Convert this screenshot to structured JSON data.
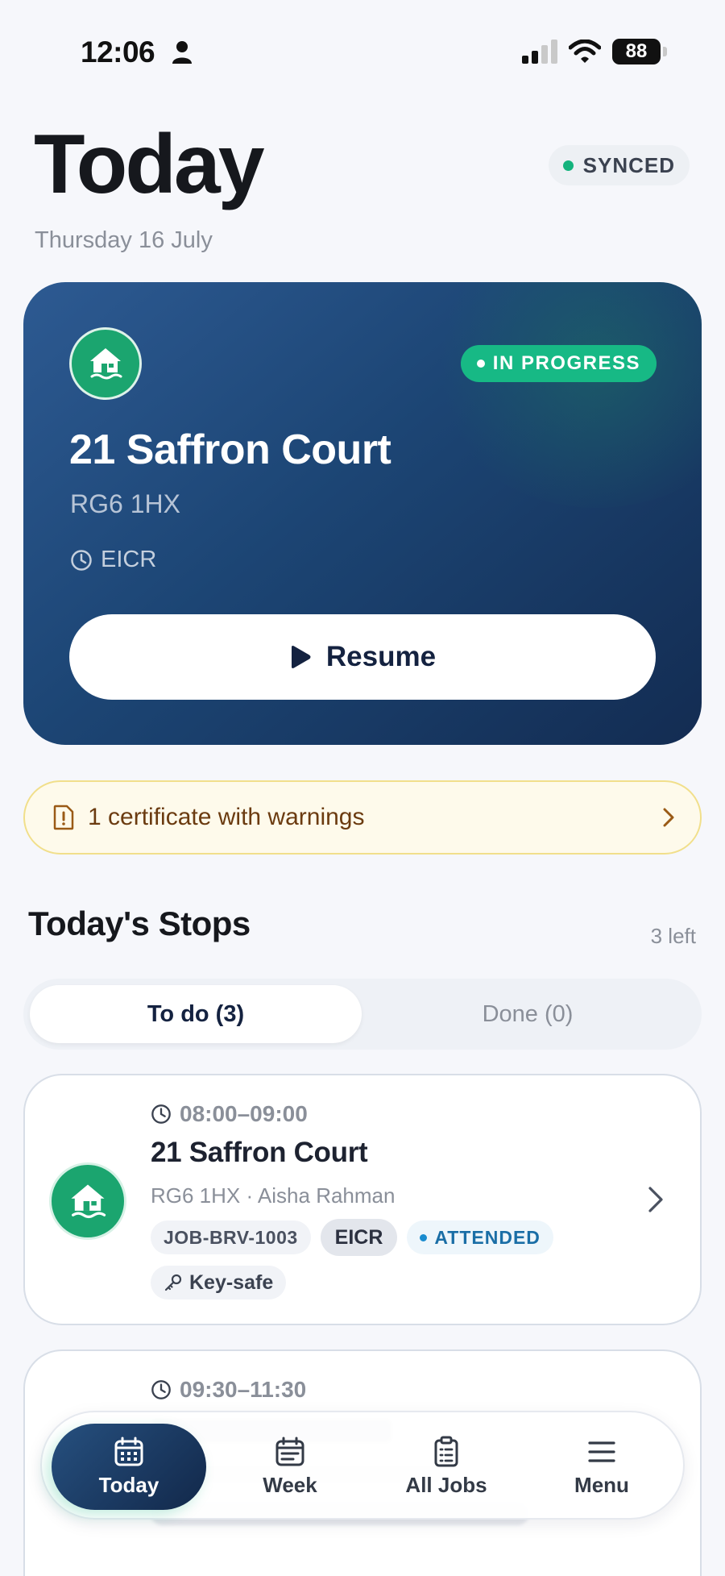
{
  "status_bar": {
    "time": "12:06",
    "battery": "88"
  },
  "header": {
    "title": "Today",
    "date": "Thursday 16 July",
    "sync_label": "SYNCED"
  },
  "hero": {
    "status": "IN PROGRESS",
    "address": "21 Saffron Court",
    "postcode": "RG6 1HX",
    "job_type": "EICR",
    "resume_label": "Resume"
  },
  "warning": {
    "text": "1 certificate with warnings"
  },
  "stops": {
    "title": "Today's Stops",
    "remaining": "3 left",
    "tabs": [
      {
        "label": "To do (3)"
      },
      {
        "label": "Done (0)"
      }
    ],
    "items": [
      {
        "time": "08:00–09:00",
        "address": "21 Saffron Court",
        "subtitle": "RG6 1HX · Aisha Rahman",
        "job_ref": "JOB-BRV-1003",
        "job_type": "EICR",
        "status": "ATTENDED",
        "access": "Key-safe"
      },
      {
        "time": "09:30–11:30"
      }
    ]
  },
  "nav": {
    "items": [
      {
        "label": "Today",
        "icon": "calendar-icon"
      },
      {
        "label": "Week",
        "icon": "calendar-week-icon"
      },
      {
        "label": "All Jobs",
        "icon": "clipboard-icon"
      },
      {
        "label": "Menu",
        "icon": "menu-icon"
      }
    ]
  },
  "colors": {
    "accent_green": "#17b985",
    "hero_navy": "#1c4574",
    "warning_bg": "#fefaeb",
    "warning_text": "#6b3b10",
    "attended_blue": "#1a6ea6"
  }
}
